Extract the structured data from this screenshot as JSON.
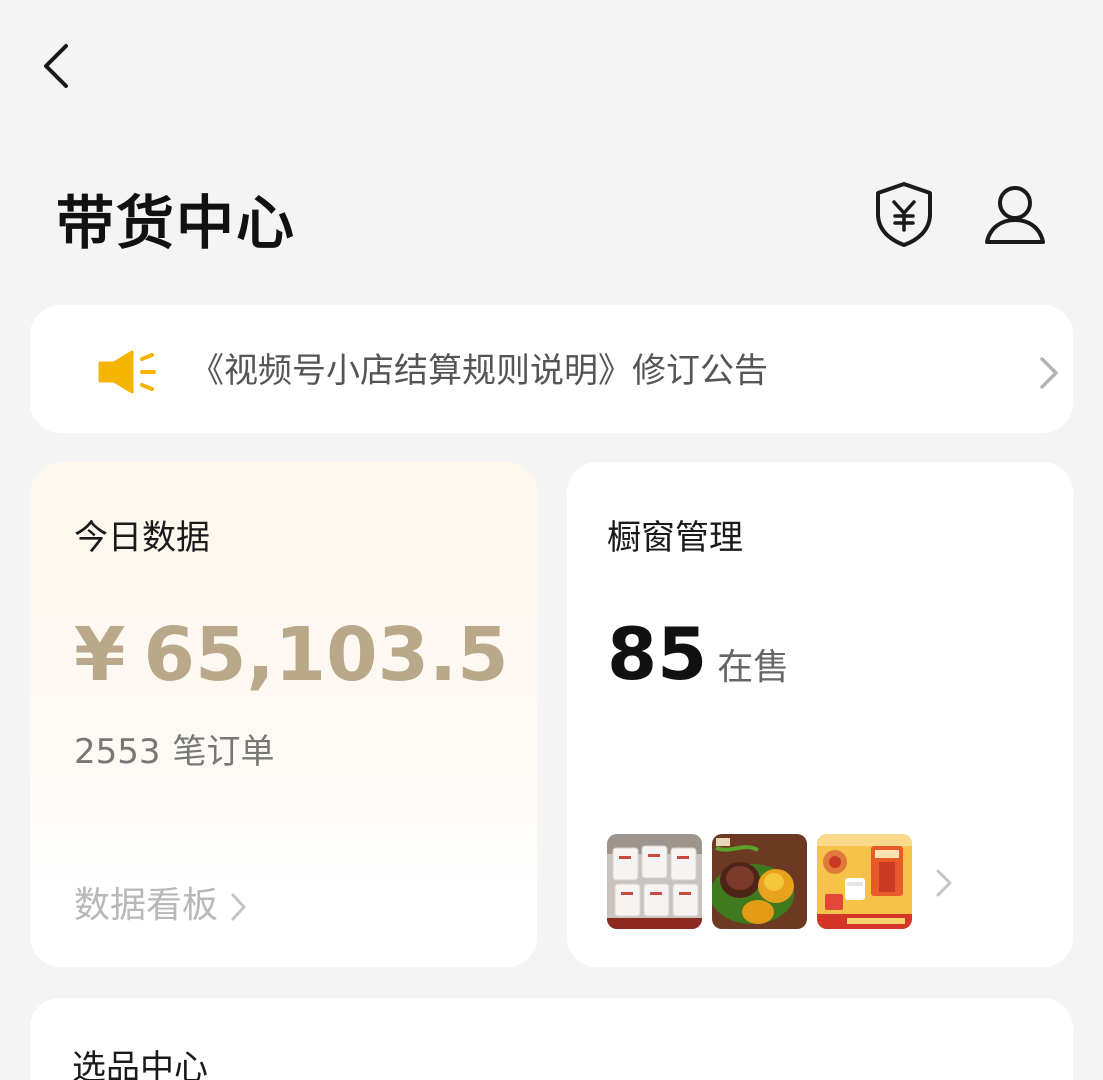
{
  "header": {
    "title": "带货中心",
    "back_icon": "chevron-left-icon",
    "shield_icon": "yuan-shield-icon",
    "user_icon": "user-icon"
  },
  "notice": {
    "icon": "speaker-icon",
    "text": "《视频号小店结算规则说明》修订公告",
    "accent": "#f5b400"
  },
  "today": {
    "title": "今日数据",
    "currency": "¥",
    "amount": "65,103.5",
    "orders_count": "2553",
    "orders_label": "笔订单",
    "dashboard_label": "数据看板",
    "amount_color": "#b9a98a"
  },
  "showcase": {
    "title": "橱窗管理",
    "count": "85",
    "count_label": "在售",
    "thumbnails": [
      {
        "name": "product-thumb-packets"
      },
      {
        "name": "product-thumb-rice-dumplings"
      },
      {
        "name": "product-thumb-food-package"
      }
    ]
  },
  "selection": {
    "title": "选品中心"
  }
}
